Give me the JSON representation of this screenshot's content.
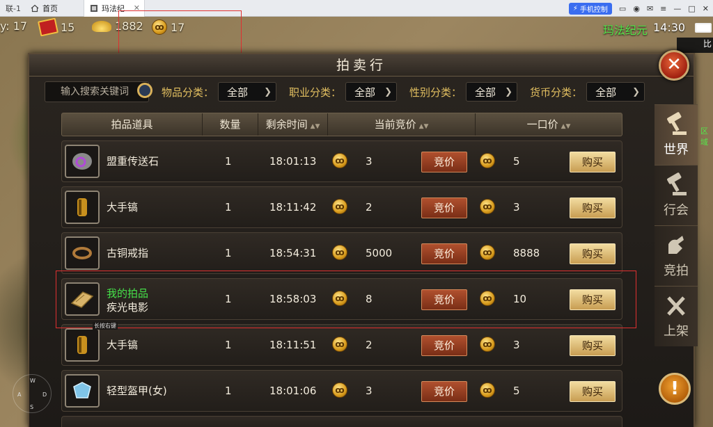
{
  "browser": {
    "tabs": [
      {
        "label": "联-1"
      },
      {
        "label": "首页"
      },
      {
        "label": "玛法纪"
      }
    ],
    "phone_control": "手机控制"
  },
  "status": {
    "level": "17",
    "tickets": "15",
    "gold": "1882",
    "coins": "17",
    "server_name": "玛法纪元",
    "clock": "14:30",
    "minimap_label": "比",
    "region_label": "区域"
  },
  "auction": {
    "title": "拍卖行",
    "search_placeholder": "输入搜索关键词",
    "filters": [
      {
        "label": "物品分类：",
        "value": "全部"
      },
      {
        "label": "职业分类：",
        "value": "全部"
      },
      {
        "label": "性别分类：",
        "value": "全部"
      },
      {
        "label": "货币分类：",
        "value": "全部"
      }
    ],
    "columns": {
      "item": "拍品道具",
      "qty": "数量",
      "time": "剩余时间",
      "bid": "当前竞价",
      "buyout": "一口价"
    },
    "bid_label": "竞价",
    "buy_label": "购买",
    "mine_label": "我的拍品",
    "tooltip": "长按右键",
    "rows": [
      {
        "name": "盟重传送石",
        "qty": "1",
        "time": "18:01:13",
        "bid": "3",
        "buyout": "5",
        "icon": "teleport-stone-icon"
      },
      {
        "name": "大手镐",
        "qty": "1",
        "time": "18:11:42",
        "bid": "2",
        "buyout": "3",
        "icon": "bracelet-icon"
      },
      {
        "name": "古铜戒指",
        "qty": "1",
        "time": "18:54:31",
        "bid": "5000",
        "buyout": "8888",
        "icon": "ring-icon"
      },
      {
        "name": "疾光电影",
        "qty": "1",
        "time": "18:58:03",
        "bid": "8",
        "buyout": "10",
        "icon": "skill-book-icon",
        "mine": true
      },
      {
        "name": "大手镐",
        "qty": "1",
        "time": "18:11:51",
        "bid": "2",
        "buyout": "3",
        "icon": "bracelet-icon"
      },
      {
        "name": "轻型盔甲(女)",
        "qty": "1",
        "time": "18:01:06",
        "bid": "3",
        "buyout": "5",
        "icon": "armor-icon"
      }
    ]
  },
  "side_tabs": [
    {
      "label": "世界",
      "active": true
    },
    {
      "label": "行会",
      "active": false
    },
    {
      "label": "竞拍",
      "active": false
    },
    {
      "label": "上架",
      "active": false
    }
  ],
  "alert_symbol": "!",
  "close_symbol": "✕",
  "joystick": {
    "w": "W",
    "a": "A",
    "s": "S",
    "d": "D"
  },
  "colors": {
    "accent_gold": "#e2bf60",
    "mine_green": "#46e24a",
    "bid_button": "#9a3e20",
    "buy_button": "#e6c985",
    "highlight": "#e03030"
  }
}
